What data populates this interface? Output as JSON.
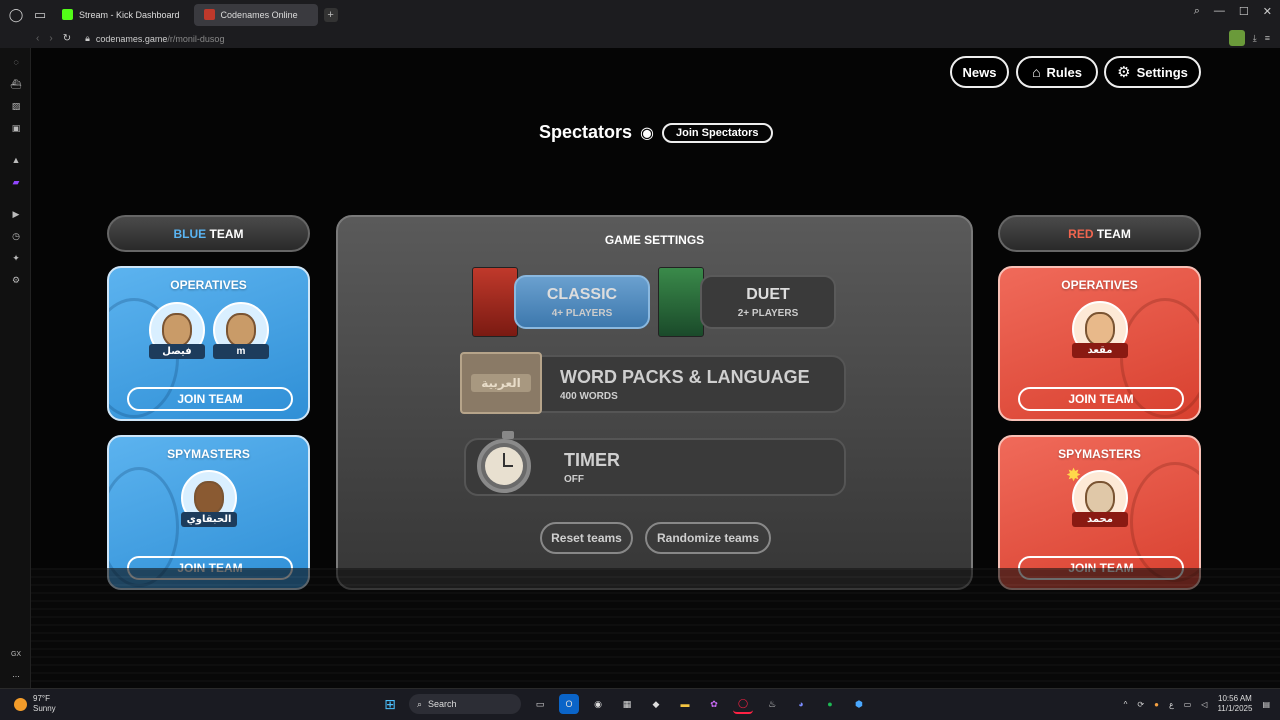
{
  "browser": {
    "tabs": [
      {
        "label": "Stream - Kick Dashboard",
        "color": "#53fc18"
      },
      {
        "label": "Codenames Online",
        "color": "#c0392b"
      }
    ],
    "new_tab": "+",
    "url_host": "codenames.game",
    "url_path": "/r/monil-dusog"
  },
  "sidebar": {
    "bottom_label": "GX",
    "more": "..."
  },
  "header": {
    "news": "News",
    "rules": "Rules",
    "settings": "Settings"
  },
  "spectators": {
    "title": "Spectators",
    "join": "Join Spectators"
  },
  "blue_team": {
    "color_word": "BLUE",
    "team_word": " TEAM",
    "accent": "#5ab4f2",
    "operatives": {
      "title": "OPERATIVES",
      "players": [
        "فيصل",
        "m"
      ],
      "join": "JOIN TEAM"
    },
    "spymasters": {
      "title": "SPYMASTERS",
      "players": [
        "الحبقاوي"
      ],
      "join": "JOIN TEAM"
    }
  },
  "red_team": {
    "color_word": "RED",
    "team_word": " TEAM",
    "accent": "#f0654f",
    "operatives": {
      "title": "OPERATIVES",
      "players": [
        "مقعد"
      ],
      "join": "JOIN TEAM"
    },
    "spymasters": {
      "title": "SPYMASTERS",
      "players": [
        "محمد"
      ],
      "join": "JOIN TEAM"
    }
  },
  "game_settings": {
    "title": "GAME SETTINGS",
    "modes": [
      {
        "name": "CLASSIC",
        "players": "4+ PLAYERS",
        "selected": true
      },
      {
        "name": "DUET",
        "players": "2+ PLAYERS",
        "selected": false
      }
    ],
    "word_packs": {
      "title": "WORD PACKS & LANGUAGE",
      "sub": "400 WORDS",
      "icon_text": "العربية"
    },
    "timer": {
      "title": "TIMER",
      "sub": "OFF"
    },
    "reset": "Reset teams",
    "randomize": "Randomize teams"
  },
  "taskbar": {
    "temp": "97°F",
    "condition": "Sunny",
    "search": "Search",
    "lang": "ع",
    "time": "10:56 AM",
    "date": "11/1/2025"
  }
}
